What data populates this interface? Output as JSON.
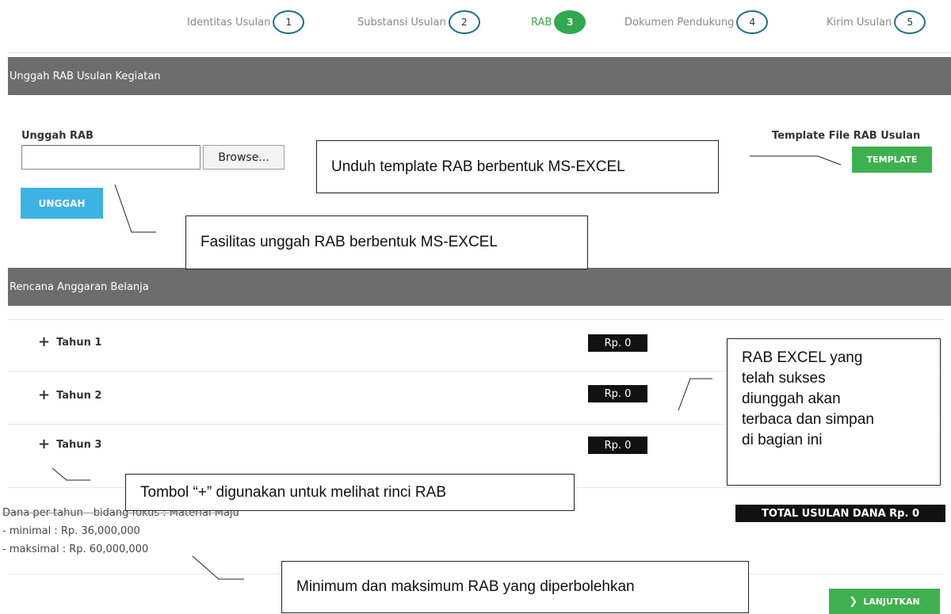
{
  "steps": [
    {
      "label": "Identitas Usulan",
      "num": "1",
      "active": false
    },
    {
      "label": "Substansi Usulan",
      "num": "2",
      "active": false
    },
    {
      "label": "RAB",
      "num": "3",
      "active": true
    },
    {
      "label": "Dokumen Pendukung",
      "num": "4",
      "active": false
    },
    {
      "label": "Kirim Usulan",
      "num": "5",
      "active": false
    }
  ],
  "upload_section": {
    "header": "Unggah RAB Usulan Kegiatan",
    "upload_label": "Unggah RAB",
    "browse_label": "Browse...",
    "file_value": "",
    "upload_button": "UNGGAH",
    "template_label": "Template File RAB Usulan",
    "template_button": "TEMPLATE"
  },
  "budget_section": {
    "header": "Rencana Anggaran Belanja",
    "years": [
      {
        "label": "Tahun 1",
        "amount": "Rp. 0"
      },
      {
        "label": "Tahun 2",
        "amount": "Rp. 0"
      },
      {
        "label": "Tahun 3",
        "amount": "Rp. 0"
      }
    ],
    "info": {
      "line1": "Dana per tahun - bidang fokus : Material Maju",
      "line2": "- minimal : Rp. 36,000,000",
      "line3": "- maksimal : Rp. 60,000,000"
    },
    "total": "TOTAL USULAN DANA Rp. 0",
    "next_button": "LANJUTKAN",
    "next_icon": "chevron-right-icon"
  },
  "callouts": {
    "template": "Unduh template RAB berbentuk MS-EXCEL",
    "upload": "Fasilitas unggah RAB berbentuk MS-EXCEL",
    "rab_excel": [
      "RAB EXCEL yang",
      "telah sukses",
      "diunggah akan",
      "terbaca dan simpan",
      "di bagian ini"
    ],
    "plus": "Tombol “+” digunakan untuk melihat rinci RAB",
    "minmax": "Minimum dan maksimum RAB yang diperbolehkan"
  },
  "colors": {
    "section_bar": "#6d6d6d",
    "active_step": "#2fa84f",
    "step_border": "#1f6d8c",
    "upload_button": "#3db3e4",
    "green_button": "#3fb04f",
    "badge": "#111111"
  }
}
